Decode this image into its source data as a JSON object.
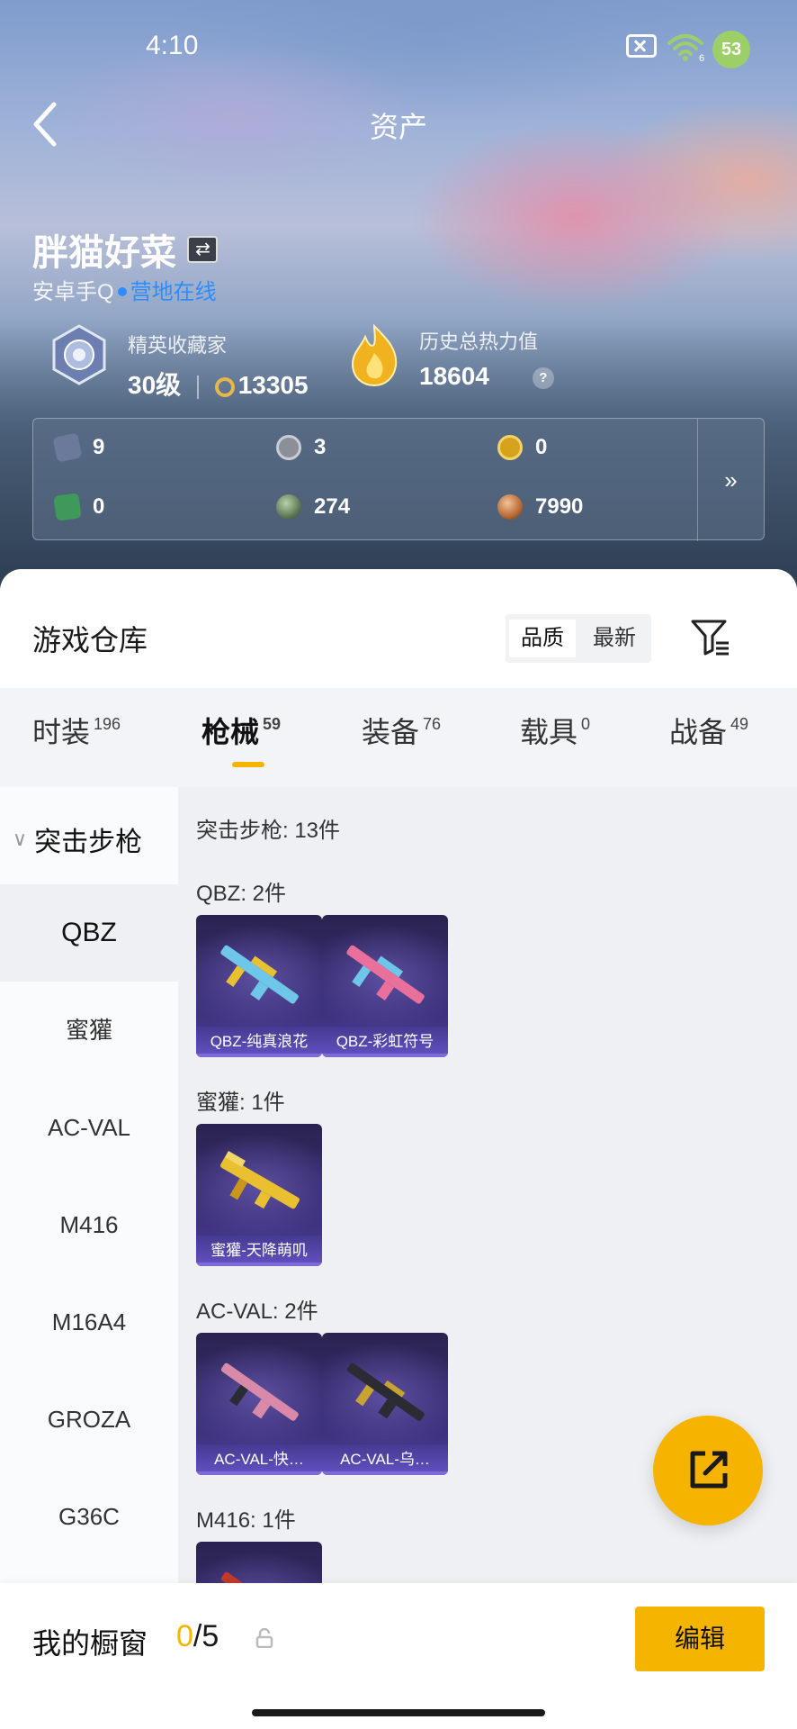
{
  "status_bar": {
    "time": "4:10",
    "wifi_badge": "6",
    "battery": "53"
  },
  "nav": {
    "title": "资产",
    "back_icon": "chevron-left-icon"
  },
  "profile": {
    "name": "胖猫好菜",
    "switch_icon": "swap-icon",
    "platform": "安卓手Q",
    "online_status": "营地在线"
  },
  "stats": {
    "collector_title": "精英收藏家",
    "level": "30级",
    "points": "13305",
    "heat_label": "历史总热力值",
    "heat_value": "18604",
    "help": "?"
  },
  "resources": [
    {
      "icon": "card-icon",
      "value": "9",
      "color": "#6b7a9a"
    },
    {
      "icon": "coin-s-icon",
      "value": "3",
      "color": "#8a8f98"
    },
    {
      "icon": "coin-gold-icon",
      "value": "0",
      "color": "#d6a21c"
    },
    {
      "icon": "ticket-green-icon",
      "value": "0",
      "color": "#3d9a5a"
    },
    {
      "icon": "orb-green-icon",
      "value": "274",
      "color": "#5d7a58"
    },
    {
      "icon": "orb-bronze-icon",
      "value": "7990",
      "color": "#b86a34"
    }
  ],
  "resources_more": "»",
  "warehouse": {
    "title": "游戏仓库",
    "sort_options": [
      "品质",
      "最新"
    ],
    "selected_sort": "品质"
  },
  "tabs": [
    {
      "label": "时装",
      "count": "196"
    },
    {
      "label": "枪械",
      "count": "59",
      "active": true
    },
    {
      "label": "装备",
      "count": "76"
    },
    {
      "label": "载具",
      "count": "0"
    },
    {
      "label": "战备",
      "count": "49"
    }
  ],
  "sidebar": {
    "category": "突击步枪",
    "items": [
      "QBZ",
      "蜜獾",
      "AC-VAL",
      "M416",
      "M16A4",
      "GROZA",
      "G36C"
    ],
    "selected": "QBZ"
  },
  "content": {
    "category_total": "突击步枪: 13件",
    "groups": [
      {
        "title": "QBZ: 2件",
        "items": [
          "QBZ-纯真浪花",
          "QBZ-彩虹符号"
        ]
      },
      {
        "title": "蜜獾: 1件",
        "items": [
          "蜜獾-天降萌叽"
        ]
      },
      {
        "title": "AC-VAL: 2件",
        "items": [
          "AC-VAL-快…",
          "AC-VAL-乌…"
        ]
      },
      {
        "title": "M416: 1件",
        "items": [
          ""
        ]
      }
    ],
    "gun_colors": [
      "#6ec6e8",
      "#e8709a",
      "#e8c030",
      "#d88aa8",
      "#c9a332",
      "#c0392b"
    ]
  },
  "fab_icon": "share-external-icon",
  "showcase": {
    "title": "我的橱窗",
    "used": "0",
    "sep_total": "/5",
    "edit_label": "编辑",
    "lock_icon": "lock-icon"
  }
}
